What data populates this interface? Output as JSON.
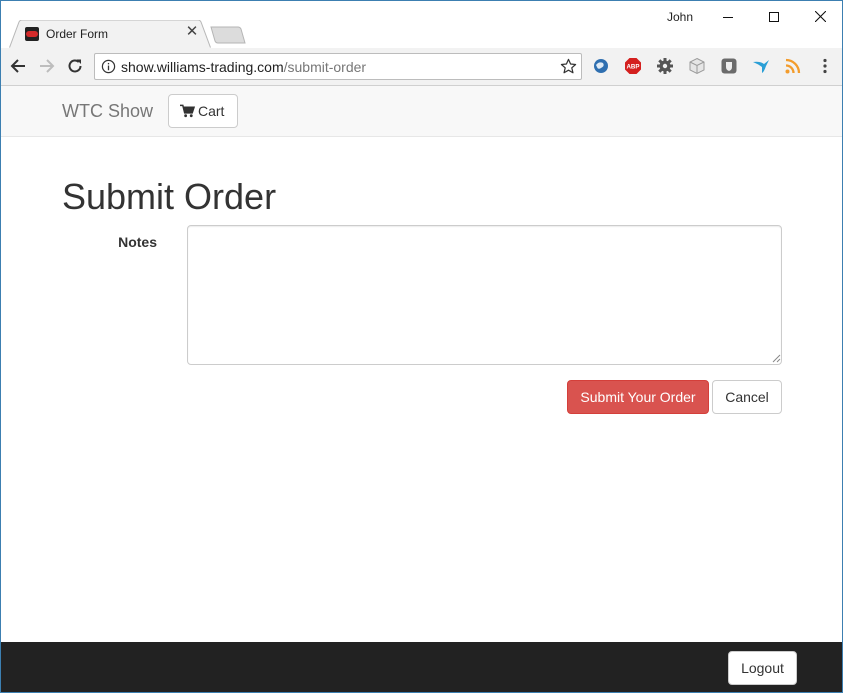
{
  "browser": {
    "tab": {
      "title": "Order Form",
      "close_glyph": "✕",
      "favicon": "wtc-favicon-icon"
    },
    "profile_name": "John",
    "window_controls": [
      "minimize-icon",
      "maximize-icon",
      "close-icon"
    ],
    "address_bar": {
      "host": "show.williams-trading.com",
      "path": "/submit-order"
    },
    "extensions": [
      "globe-icon",
      "adblock-icon",
      "gear-icon",
      "cube-icon",
      "shield-icon",
      "bird-icon",
      "rss-icon"
    ]
  },
  "navbar": {
    "brand": "WTC Show",
    "cart_label": "Cart"
  },
  "form": {
    "title": "Submit Order",
    "notes_label": "Notes",
    "notes_value": "",
    "submit_label": "Submit Your Order",
    "cancel_label": "Cancel"
  },
  "footer": {
    "logout_label": "Logout"
  },
  "colors": {
    "danger": "#d9534f",
    "footer_bg": "#222222",
    "navbar_bg": "#f8f8f8"
  }
}
